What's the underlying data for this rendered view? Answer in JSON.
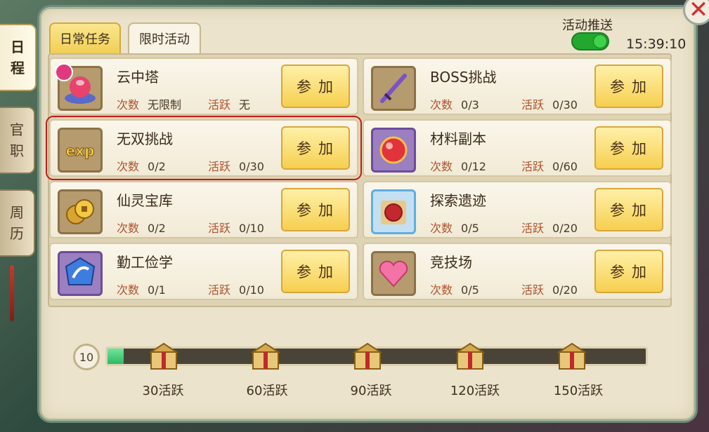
{
  "sidebar": {
    "tabs": [
      {
        "chars": [
          "日",
          "程"
        ]
      },
      {
        "chars": [
          "官",
          "职"
        ]
      },
      {
        "chars": [
          "周",
          "历"
        ]
      }
    ]
  },
  "header": {
    "tabs": [
      "日常任务",
      "限时活动"
    ],
    "push_label": "活动推送",
    "toggle_on": true,
    "clock": "15:39:10",
    "close_label": "✕"
  },
  "activities": [
    {
      "name": "云中塔",
      "count_label": "次数",
      "count": "无限制",
      "active_label": "活跃",
      "active": "无",
      "button": "参加",
      "icon": "tower-icon"
    },
    {
      "name": "BOSS挑战",
      "count_label": "次数",
      "count": "0/3",
      "active_label": "活跃",
      "active": "0/30",
      "button": "参加",
      "icon": "sword-icon"
    },
    {
      "name": "无双挑战",
      "count_label": "次数",
      "count": "0/2",
      "active_label": "活跃",
      "active": "0/30",
      "button": "参加",
      "icon": "exp-icon"
    },
    {
      "name": "材料副本",
      "count_label": "次数",
      "count": "0/12",
      "active_label": "活跃",
      "active": "0/60",
      "button": "参加",
      "icon": "orb-icon"
    },
    {
      "name": "仙灵宝库",
      "count_label": "次数",
      "count": "0/2",
      "active_label": "活跃",
      "active": "0/10",
      "button": "参加",
      "icon": "coins-icon"
    },
    {
      "name": "探索遗迹",
      "count_label": "次数",
      "count": "0/5",
      "active_label": "活跃",
      "active": "0/20",
      "button": "参加",
      "icon": "relic-icon"
    },
    {
      "name": "勤工俭学",
      "count_label": "次数",
      "count": "0/1",
      "active_label": "活跃",
      "active": "0/10",
      "button": "参加",
      "icon": "badge-icon"
    },
    {
      "name": "竞技场",
      "count_label": "次数",
      "count": "0/5",
      "active_label": "活跃",
      "active": "0/20",
      "button": "参加",
      "icon": "heart-icon"
    }
  ],
  "exp_icon_text": "exp",
  "progress": {
    "current": "10",
    "fill_fraction": 0.03,
    "milestones": [
      "30活跃",
      "60活跃",
      "90活跃",
      "120活跃",
      "150活跃"
    ]
  },
  "colors": {
    "accent_gold": "#f6cf4f",
    "progress_green": "#2fb865",
    "toggle_green": "#23a72e",
    "selection_red": "#c41a1a"
  }
}
